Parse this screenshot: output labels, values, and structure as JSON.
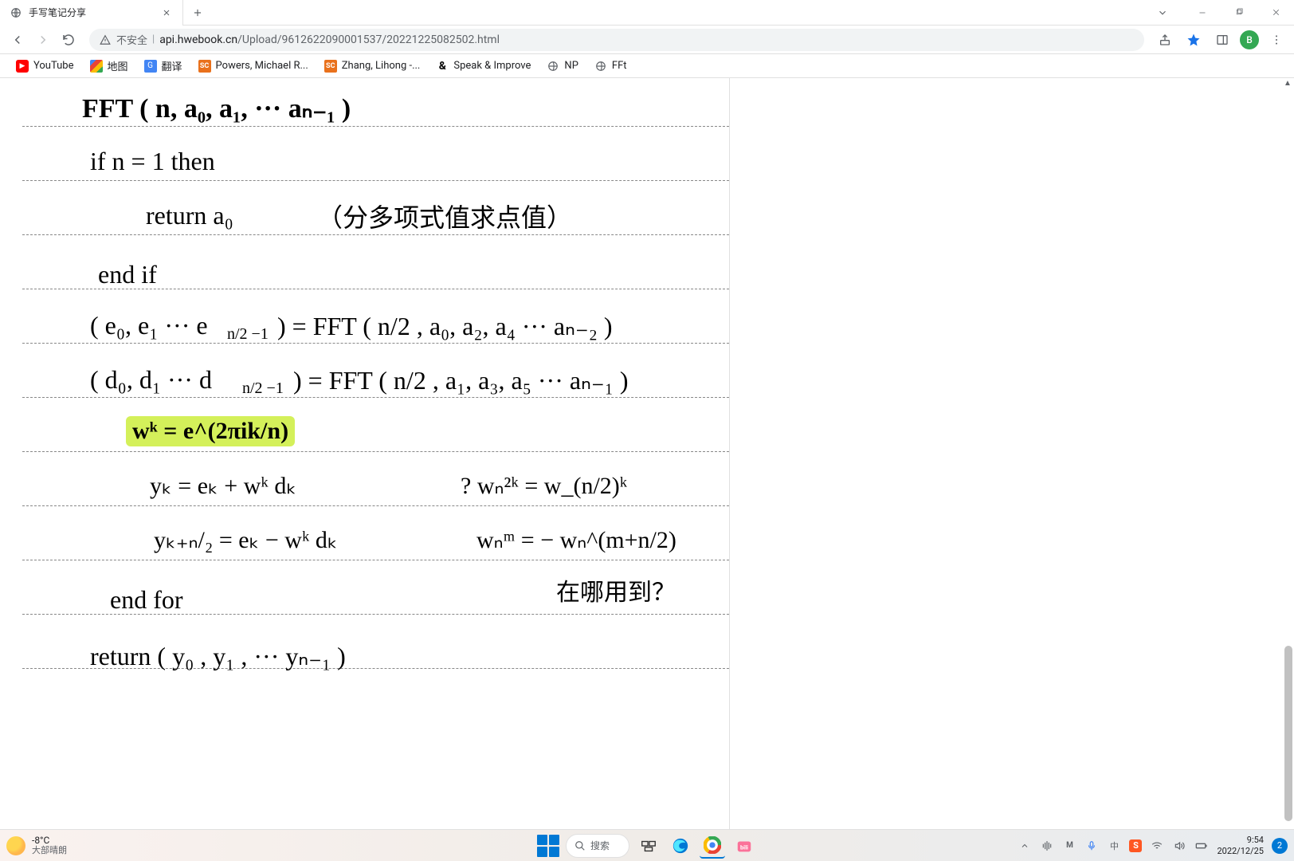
{
  "tab": {
    "title": "手写笔记分享"
  },
  "url": {
    "security_label": "不安全",
    "host": "api.hwebook.cn",
    "path": "/Upload/9612622090001537/20221225082502.html"
  },
  "avatar_letter": "B",
  "bookmarks": [
    {
      "label": "YouTube"
    },
    {
      "label": "地图"
    },
    {
      "label": "翻译"
    },
    {
      "label": "Powers, Michael R..."
    },
    {
      "label": "Zhang, Lihong -..."
    },
    {
      "label": "Speak & Improve"
    },
    {
      "label": "NP"
    },
    {
      "label": "FFt"
    }
  ],
  "notes": {
    "l1": "FFT ( n, a₀, a₁, ··· aₙ₋₁ )",
    "l2": "if n = 1 then",
    "l3": "return a₀",
    "l3c": "（分多项式值求点值）",
    "l4": "end if",
    "l5a": "( e₀, e₁ ··· e",
    "l5sub": "n/2 −1",
    "l5b": ") = FFT ( n/2 , a₀, a₂, a₄ ··· aₙ₋₂ )",
    "l6a": "( d₀, d₁ ··· d",
    "l6sub": "n/2 −1",
    "l6b": ") = FFT ( n/2 , a₁, a₃, a₅ ··· aₙ₋₁ )",
    "l7": "wᵏ = e^(2πik/n)",
    "l8": "yₖ = eₖ + wᵏ dₖ",
    "l8r": "?  wₙ²ᵏ = w_(n/2)ᵏ",
    "l9": "yₖ₊ₙ/₂ = eₖ − wᵏ dₖ",
    "l9r": "wₙᵐ  = − wₙ^(m+n/2)",
    "l10": "end for",
    "l10r": "在哪用到？",
    "l11": "return ( y₀ , y₁ , ··· yₙ₋₁ )"
  },
  "taskbar": {
    "temp": "-8°C",
    "desc": "大部晴朗",
    "search": "搜索",
    "time": "9:54",
    "date": "2022/12/25",
    "notif": "2"
  }
}
